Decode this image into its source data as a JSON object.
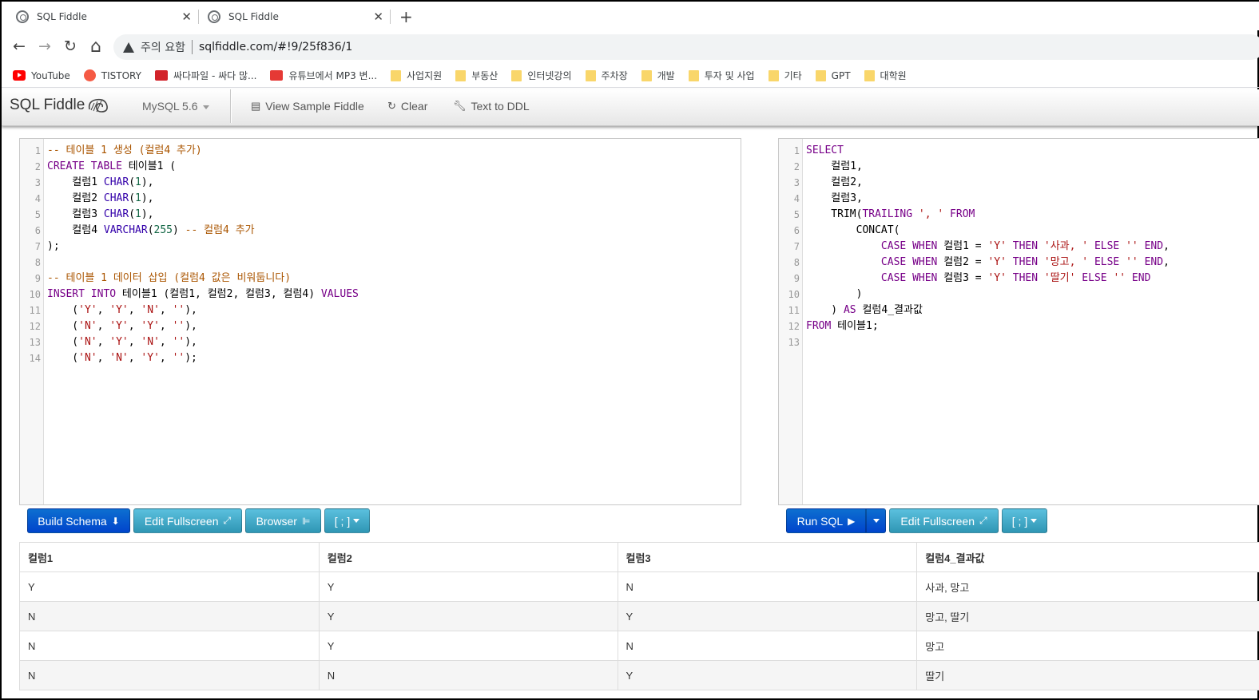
{
  "browser": {
    "tabs": [
      {
        "title": "SQL Fiddle",
        "close": "✕"
      },
      {
        "title": "SQL Fiddle",
        "close": "✕"
      }
    ],
    "new_tab": "+",
    "nav": {
      "back": "←",
      "forward": "→",
      "reload": "↻",
      "home": "⌂"
    },
    "omnibox": {
      "warning": "주의 요함",
      "url": "sqlfiddle.com/#!9/25f836/1"
    },
    "bookmarks": [
      "YouTube",
      "TISTORY",
      "싸다파일 - 싸다 많...",
      "유튜브에서 MP3 변...",
      "사업지원",
      "부동산",
      "인터넷강의",
      "주차장",
      "개발",
      "투자 및 사업",
      "기타",
      "GPT",
      "대학원"
    ]
  },
  "header": {
    "brand": "SQL Fiddle",
    "db": "MySQL 5.6",
    "view_sample": "View Sample Fiddle",
    "clear": "Clear",
    "text_to_ddl": "Text to DDL"
  },
  "schema_editor": {
    "lines": [
      [
        {
          "t": "-- 테이블 1 생성 (컬럼4 추가)",
          "c": "cm"
        }
      ],
      [
        {
          "t": "CREATE",
          "c": "kw"
        },
        {
          "t": " "
        },
        {
          "t": "TABLE",
          "c": "kw"
        },
        {
          "t": " 테이블1 ("
        }
      ],
      [
        {
          "t": "    컬럼1 "
        },
        {
          "t": "CHAR",
          "c": "ty"
        },
        {
          "t": "("
        },
        {
          "t": "1",
          "c": "nu"
        },
        {
          "t": "),"
        }
      ],
      [
        {
          "t": "    컬럼2 "
        },
        {
          "t": "CHAR",
          "c": "ty"
        },
        {
          "t": "("
        },
        {
          "t": "1",
          "c": "nu"
        },
        {
          "t": "),"
        }
      ],
      [
        {
          "t": "    컬럼3 "
        },
        {
          "t": "CHAR",
          "c": "ty"
        },
        {
          "t": "("
        },
        {
          "t": "1",
          "c": "nu"
        },
        {
          "t": "),"
        }
      ],
      [
        {
          "t": "    컬럼4 "
        },
        {
          "t": "VARCHAR",
          "c": "ty"
        },
        {
          "t": "("
        },
        {
          "t": "255",
          "c": "nu"
        },
        {
          "t": ") "
        },
        {
          "t": "-- 컬럼4 추가",
          "c": "cm"
        }
      ],
      [
        {
          "t": ");"
        }
      ],
      [
        {
          "t": ""
        }
      ],
      [
        {
          "t": "-- 테이블 1 데이터 삽입 (컬럼4 값은 비워둡니다)",
          "c": "cm"
        }
      ],
      [
        {
          "t": "INSERT",
          "c": "kw"
        },
        {
          "t": " "
        },
        {
          "t": "INTO",
          "c": "kw"
        },
        {
          "t": " 테이블1 (컬럼1, 컬럼2, 컬럼3, 컬럼4) "
        },
        {
          "t": "VALUES",
          "c": "kw"
        }
      ],
      [
        {
          "t": "    ("
        },
        {
          "t": "'Y'",
          "c": "st"
        },
        {
          "t": ", "
        },
        {
          "t": "'Y'",
          "c": "st"
        },
        {
          "t": ", "
        },
        {
          "t": "'N'",
          "c": "st"
        },
        {
          "t": ", "
        },
        {
          "t": "''",
          "c": "st"
        },
        {
          "t": "),"
        }
      ],
      [
        {
          "t": "    ("
        },
        {
          "t": "'N'",
          "c": "st"
        },
        {
          "t": ", "
        },
        {
          "t": "'Y'",
          "c": "st"
        },
        {
          "t": ", "
        },
        {
          "t": "'Y'",
          "c": "st"
        },
        {
          "t": ", "
        },
        {
          "t": "''",
          "c": "st"
        },
        {
          "t": "),"
        }
      ],
      [
        {
          "t": "    ("
        },
        {
          "t": "'N'",
          "c": "st"
        },
        {
          "t": ", "
        },
        {
          "t": "'Y'",
          "c": "st"
        },
        {
          "t": ", "
        },
        {
          "t": "'N'",
          "c": "st"
        },
        {
          "t": ", "
        },
        {
          "t": "''",
          "c": "st"
        },
        {
          "t": "),"
        }
      ],
      [
        {
          "t": "    ("
        },
        {
          "t": "'N'",
          "c": "st"
        },
        {
          "t": ", "
        },
        {
          "t": "'N'",
          "c": "st"
        },
        {
          "t": ", "
        },
        {
          "t": "'Y'",
          "c": "st"
        },
        {
          "t": ", "
        },
        {
          "t": "''",
          "c": "st"
        },
        {
          "t": ");"
        }
      ]
    ]
  },
  "query_editor": {
    "lines": [
      [
        {
          "t": "SELECT",
          "c": "kw"
        }
      ],
      [
        {
          "t": "    컬럼1,"
        }
      ],
      [
        {
          "t": "    컬럼2,"
        }
      ],
      [
        {
          "t": "    컬럼3,"
        }
      ],
      [
        {
          "t": "    TRIM(",
          "c": ""
        },
        {
          "t": "TRAILING",
          "c": "kw"
        },
        {
          "t": " "
        },
        {
          "t": "', '",
          "c": "st"
        },
        {
          "t": " "
        },
        {
          "t": "FROM",
          "c": "kw"
        }
      ],
      [
        {
          "t": "        CONCAT("
        }
      ],
      [
        {
          "t": "            "
        },
        {
          "t": "CASE",
          "c": "kw"
        },
        {
          "t": " "
        },
        {
          "t": "WHEN",
          "c": "kw"
        },
        {
          "t": " 컬럼1 = "
        },
        {
          "t": "'Y'",
          "c": "st"
        },
        {
          "t": " "
        },
        {
          "t": "THEN",
          "c": "kw"
        },
        {
          "t": " "
        },
        {
          "t": "'사과, '",
          "c": "st"
        },
        {
          "t": " "
        },
        {
          "t": "ELSE",
          "c": "kw"
        },
        {
          "t": " "
        },
        {
          "t": "''",
          "c": "st"
        },
        {
          "t": " "
        },
        {
          "t": "END",
          "c": "kw"
        },
        {
          "t": ","
        }
      ],
      [
        {
          "t": "            "
        },
        {
          "t": "CASE",
          "c": "kw"
        },
        {
          "t": " "
        },
        {
          "t": "WHEN",
          "c": "kw"
        },
        {
          "t": " 컬럼2 = "
        },
        {
          "t": "'Y'",
          "c": "st"
        },
        {
          "t": " "
        },
        {
          "t": "THEN",
          "c": "kw"
        },
        {
          "t": " "
        },
        {
          "t": "'망고, '",
          "c": "st"
        },
        {
          "t": " "
        },
        {
          "t": "ELSE",
          "c": "kw"
        },
        {
          "t": " "
        },
        {
          "t": "''",
          "c": "st"
        },
        {
          "t": " "
        },
        {
          "t": "END",
          "c": "kw"
        },
        {
          "t": ","
        }
      ],
      [
        {
          "t": "            "
        },
        {
          "t": "CASE",
          "c": "kw"
        },
        {
          "t": " "
        },
        {
          "t": "WHEN",
          "c": "kw"
        },
        {
          "t": " 컬럼3 = "
        },
        {
          "t": "'Y'",
          "c": "st"
        },
        {
          "t": " "
        },
        {
          "t": "THEN",
          "c": "kw"
        },
        {
          "t": " "
        },
        {
          "t": "'딸기'",
          "c": "st"
        },
        {
          "t": " "
        },
        {
          "t": "ELSE",
          "c": "kw"
        },
        {
          "t": " "
        },
        {
          "t": "''",
          "c": "st"
        },
        {
          "t": " "
        },
        {
          "t": "END",
          "c": "kw"
        }
      ],
      [
        {
          "t": "        )"
        }
      ],
      [
        {
          "t": "    ) "
        },
        {
          "t": "AS",
          "c": "kw"
        },
        {
          "t": " 컬럼4_결과값"
        }
      ],
      [
        {
          "t": "FROM",
          "c": "kw"
        },
        {
          "t": " 테이블1;"
        }
      ],
      [
        {
          "t": ""
        }
      ]
    ]
  },
  "schema_buttons": {
    "build": "Build Schema",
    "fullscreen": "Edit Fullscreen",
    "browser": "Browser",
    "terminator": "[ ; ]"
  },
  "query_buttons": {
    "run": "Run SQL",
    "fullscreen": "Edit Fullscreen",
    "terminator": "[ ; ]"
  },
  "results": {
    "columns": [
      "컬럼1",
      "컬럼2",
      "컬럼3",
      "컬럼4_결과값"
    ],
    "rows": [
      [
        "Y",
        "Y",
        "N",
        "사과, 망고"
      ],
      [
        "N",
        "Y",
        "Y",
        "망고, 딸기"
      ],
      [
        "N",
        "Y",
        "N",
        "망고"
      ],
      [
        "N",
        "N",
        "Y",
        "딸기"
      ]
    ]
  },
  "colors": {
    "primary": "#0044cc",
    "info": "#2f96b4",
    "keyword": "#770088",
    "comment": "#aa5500",
    "string": "#aa1111"
  }
}
